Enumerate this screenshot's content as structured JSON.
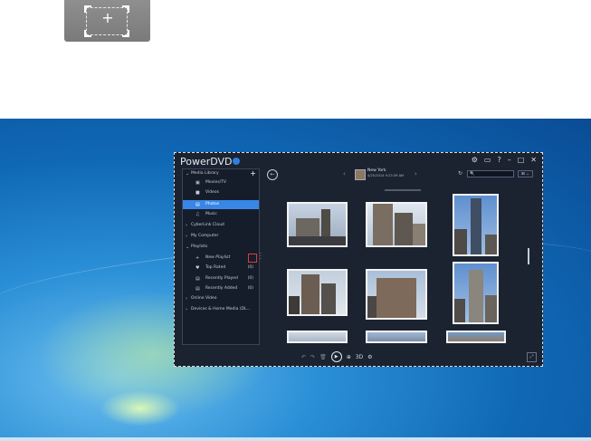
{
  "capture": {
    "plus": "+"
  },
  "app": {
    "title": "PowerDVD",
    "window_controls": [
      "⚙",
      "▭",
      "?",
      "–",
      "□",
      "✕"
    ],
    "sidebar": {
      "add": "+",
      "items": [
        {
          "label": "Media Library",
          "chev": "⌄"
        },
        {
          "label": "Movies/TV",
          "icon": "▣"
        },
        {
          "label": "Videos",
          "icon": "■"
        },
        {
          "label": "Photos",
          "icon": "▤"
        },
        {
          "label": "Music",
          "icon": "♫"
        },
        {
          "label": "CyberLink Cloud",
          "chev": "›"
        },
        {
          "label": "My Computer",
          "chev": "›"
        },
        {
          "label": "Playlists",
          "chev": "⌄"
        },
        {
          "label": "New Playlist",
          "icon": "+"
        },
        {
          "label": "Top Rated",
          "icon": "♥",
          "count": "(0)"
        },
        {
          "label": "Recently Played",
          "icon": "▤",
          "count": "(0)"
        },
        {
          "label": "Recently Added",
          "icon": "▤",
          "count": "(0)"
        },
        {
          "label": "Online Video",
          "chev": "›"
        },
        {
          "label": "Devices & Home Media (DL...",
          "chev": "›"
        }
      ]
    },
    "header": {
      "back": "←",
      "prev": "‹",
      "next": "›",
      "album_title": "New York",
      "album_date": "4/25/2014 9:23:39 AM",
      "refresh": "↻",
      "search_icon": "🔍",
      "view": "⊞ ⌄"
    },
    "toolbar": {
      "undo": "↶",
      "redo": "↷",
      "delete": "🗑",
      "play": "▶",
      "zoom": "⊕",
      "three_d": "3D",
      "settings": "⚙"
    },
    "corner": "⤢"
  },
  "colors": {
    "accent": "#3a86e6",
    "highlight": "#e23b3b"
  }
}
